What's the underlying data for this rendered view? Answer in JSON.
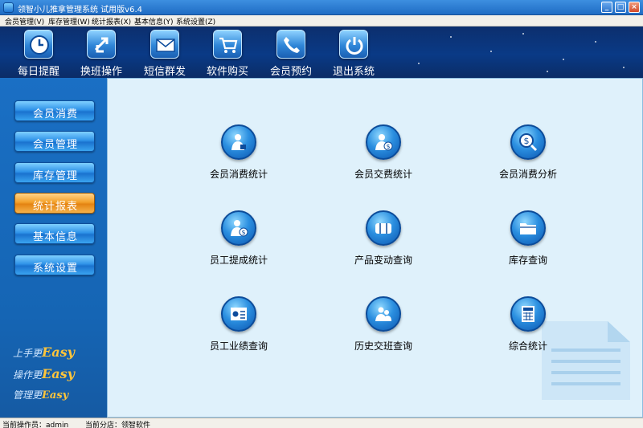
{
  "window": {
    "title": "领智小儿推拿管理系统 试用版v6.4"
  },
  "menu": [
    "会员管理(V)",
    "库存管理(W)",
    "统计报表(X)",
    "基本信息(Y)",
    "系统设置(Z)"
  ],
  "toolbar": [
    {
      "label": "每日提醒",
      "icon": "clock-icon"
    },
    {
      "label": "换班操作",
      "icon": "swap-arrows-icon"
    },
    {
      "label": "短信群发",
      "icon": "envelope-icon"
    },
    {
      "label": "软件购买",
      "icon": "shopping-cart-icon"
    },
    {
      "label": "会员预约",
      "icon": "telephone-icon"
    },
    {
      "label": "退出系统",
      "icon": "power-icon"
    }
  ],
  "sidebar": {
    "items": [
      {
        "label": "会员消费",
        "active": false
      },
      {
        "label": "会员管理",
        "active": false
      },
      {
        "label": "库存管理",
        "active": false
      },
      {
        "label": "统计报表",
        "active": true
      },
      {
        "label": "基本信息",
        "active": false
      },
      {
        "label": "系统设置",
        "active": false
      }
    ],
    "slogans": [
      {
        "text": "上手更",
        "easy": "Easy"
      },
      {
        "text": "操作更",
        "easy": "Easy"
      },
      {
        "text": "管理更",
        "easy": "Easy"
      }
    ]
  },
  "functions": [
    {
      "label": "会员消费统计",
      "icon": "member-consumption-icon"
    },
    {
      "label": "会员交费统计",
      "icon": "member-payment-icon"
    },
    {
      "label": "会员消费分析",
      "icon": "consumption-analysis-icon"
    },
    {
      "label": "员工提成统计",
      "icon": "staff-commission-icon"
    },
    {
      "label": "产品变动查询",
      "icon": "product-change-icon"
    },
    {
      "label": "库存查询",
      "icon": "folder-icon"
    },
    {
      "label": "员工业绩查询",
      "icon": "staff-performance-icon"
    },
    {
      "label": "历史交班查询",
      "icon": "shift-history-icon"
    },
    {
      "label": "综合统计",
      "icon": "calculator-icon"
    }
  ],
  "status": {
    "operator": "当前操作员：admin",
    "branch": "当前分店：领智软件"
  },
  "colors": {
    "accent": "#1565b4",
    "active": "#f3a12b",
    "content_bg": "#dff1fb"
  }
}
